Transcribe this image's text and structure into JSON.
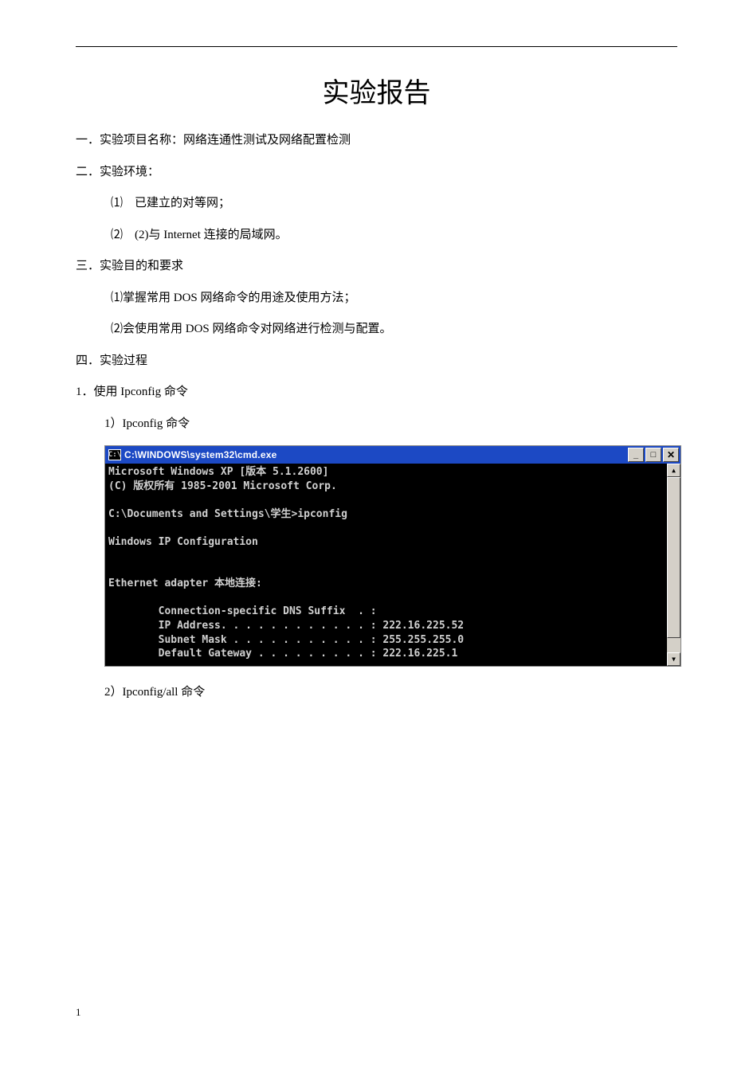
{
  "doc": {
    "title": "实验报告",
    "section1": "一．实验项目名称：网络连通性测试及网络配置检测",
    "section2": "二．实验环境：",
    "env1": "⑴　已建立的对等网；",
    "env2": "⑵　(2)与 Internet 连接的局域网。",
    "section3": "三．实验目的和要求",
    "goal1": "⑴掌握常用 DOS 网络命令的用途及使用方法；",
    "goal2": "⑵会使用常用 DOS 网络命令对网络进行检测与配置。",
    "section4": "四．实验过程",
    "step1": "1．使用 Ipconfig 命令",
    "step1_1": "1）Ipconfig 命令",
    "step1_2": "2）Ipconfig/all 命令",
    "page_number": "1"
  },
  "cmd": {
    "icon_text": "C:\\",
    "title": "C:\\WINDOWS\\system32\\cmd.exe",
    "min_label": "_",
    "max_label": "□",
    "close_label": "✕",
    "up_arrow": "▲",
    "down_arrow": "▼",
    "body": "Microsoft Windows XP [版本 5.1.2600]\n(C) 版权所有 1985-2001 Microsoft Corp.\n\nC:\\Documents and Settings\\学生>ipconfig\n\nWindows IP Configuration\n\n\nEthernet adapter 本地连接:\n\n        Connection-specific DNS Suffix  . :\n        IP Address. . . . . . . . . . . . : 222.16.225.52\n        Subnet Mask . . . . . . . . . . . : 255.255.255.0\n        Default Gateway . . . . . . . . . : 222.16.225.1"
  }
}
